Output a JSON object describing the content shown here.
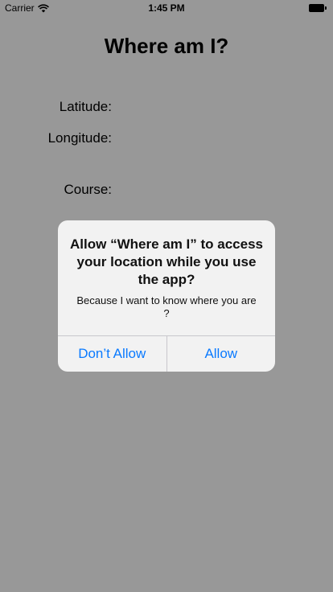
{
  "status_bar": {
    "carrier": "Carrier",
    "time": "1:45 PM",
    "wifi_icon": "wifi-icon",
    "battery_icon": "battery-icon"
  },
  "page": {
    "title": "Where am I?",
    "labels": {
      "latitude": "Latitude:",
      "longitude": "Longitude:",
      "course": "Course:"
    }
  },
  "alert": {
    "title": "Allow “Where am I” to access your location while you use the app?",
    "message": "Because I want to know where you are ?",
    "buttons": {
      "dont_allow": "Don’t Allow",
      "allow": "Allow"
    },
    "accent_color": "#0a7aff"
  }
}
